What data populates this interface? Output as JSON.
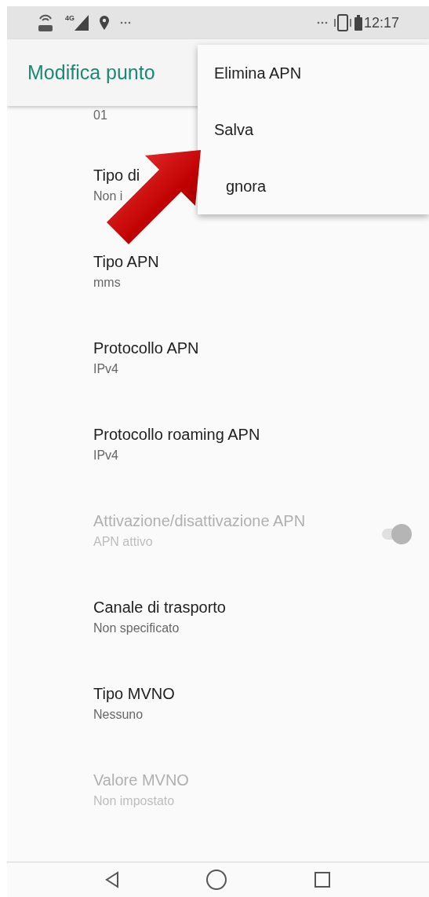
{
  "status_bar": {
    "network": "4G",
    "time": "12:17"
  },
  "app_bar": {
    "title": "Modifica punto"
  },
  "list": {
    "partial_summary": "01",
    "items": [
      {
        "kind": "text",
        "title": "Tipo di",
        "summary": "Non i",
        "disabled": false
      },
      {
        "kind": "text",
        "title": "Tipo APN",
        "summary": "mms",
        "disabled": false
      },
      {
        "kind": "text",
        "title": "Protocollo APN",
        "summary": "IPv4",
        "disabled": false
      },
      {
        "kind": "text",
        "title": "Protocollo roaming APN",
        "summary": "IPv4",
        "disabled": false
      },
      {
        "kind": "switch",
        "title": "Attivazione/disattivazione APN",
        "summary": "APN attivo",
        "disabled": true,
        "on": true
      },
      {
        "kind": "text",
        "title": "Canale di trasporto",
        "summary": "Non specificato",
        "disabled": false
      },
      {
        "kind": "text",
        "title": "Tipo MVNO",
        "summary": "Nessuno",
        "disabled": false
      },
      {
        "kind": "text",
        "title": "Valore MVNO",
        "summary": "Non impostato",
        "disabled": true
      }
    ]
  },
  "overflow_menu": {
    "items": [
      "Elimina APN",
      "Salva",
      "gnora"
    ]
  }
}
